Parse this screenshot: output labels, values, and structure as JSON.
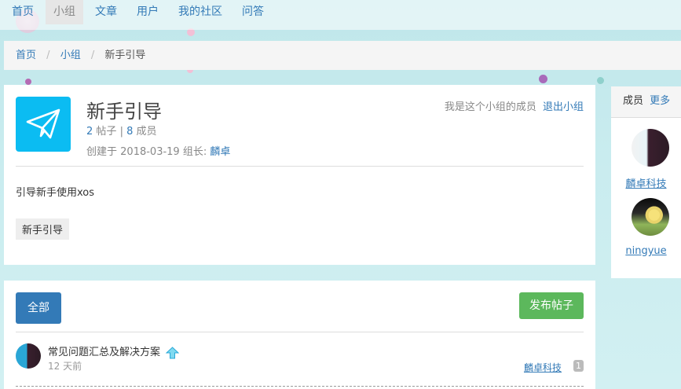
{
  "nav": {
    "items": [
      {
        "label": "首页",
        "active": false
      },
      {
        "label": "小组",
        "active": true
      },
      {
        "label": "文章",
        "active": false
      },
      {
        "label": "用户",
        "active": false
      },
      {
        "label": "我的社区",
        "active": false
      },
      {
        "label": "问答",
        "active": false
      }
    ]
  },
  "breadcrumb": {
    "home": "首页",
    "sep": "/",
    "groups": "小组",
    "current": "新手引导"
  },
  "group": {
    "icon": "paper-plane-icon",
    "title": "新手引导",
    "post_count": "2",
    "post_label": "帖子",
    "stats_sep": "|",
    "member_count": "8",
    "member_label": "成员",
    "created_prefix": "创建于",
    "created_date": "2018-03-19",
    "owner_label": "组长:",
    "owner_name": "麟卓",
    "member_status": "我是这个小组的成员",
    "leave_label": "退出小组",
    "description": "引导新手使用xos",
    "tag": "新手引导",
    "accent": "#0bbcf2"
  },
  "posts": {
    "filter_all": "全部",
    "publish": "发布帖子",
    "items": [
      {
        "title": "常见问题汇总及解决方案",
        "icon": "up-arrow-icon",
        "time": "12 天前",
        "author": "麟卓科技",
        "reply_count": "1"
      }
    ]
  },
  "members": {
    "heading": "成员",
    "more": "更多",
    "list": [
      {
        "name": "麟卓科技"
      },
      {
        "name": "ningyue"
      }
    ]
  },
  "colors": {
    "link": "#337ab7",
    "primary_btn": "#337ab7",
    "success_btn": "#5cb85c"
  }
}
